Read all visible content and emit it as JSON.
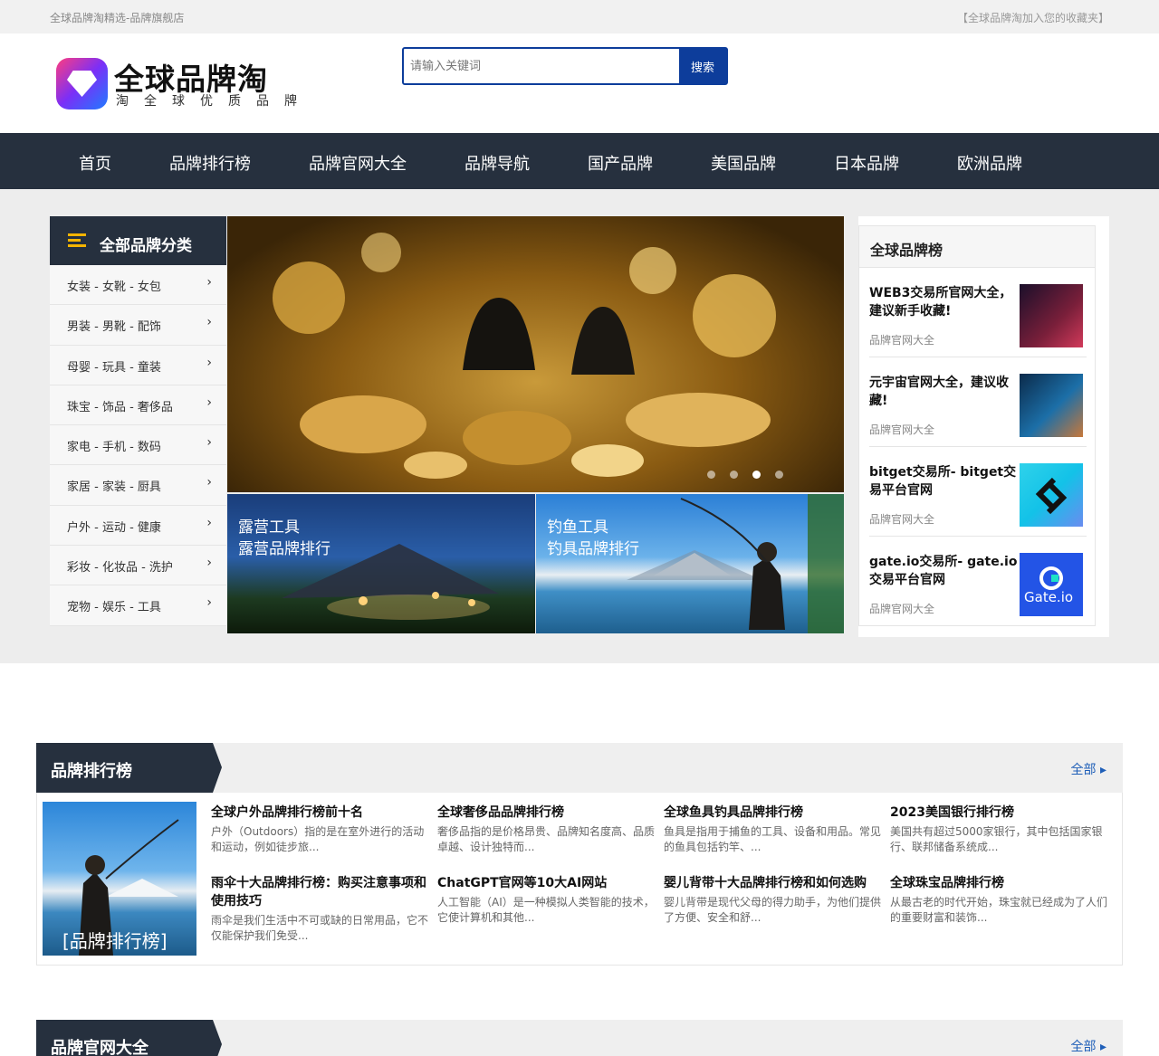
{
  "topbar": {
    "left_a": "全球品牌淘精选",
    "left_b": "-品牌旗舰店",
    "right": "【全球品牌淘加入您的收藏夹】"
  },
  "logo": {
    "name": "全球品牌淘",
    "slogan": "淘全球优质品牌"
  },
  "search": {
    "placeholder": "请输入关键词",
    "button": "搜索"
  },
  "nav": [
    "首页",
    "品牌排行榜",
    "品牌官网大全",
    "品牌导航",
    "国产品牌",
    "美国品牌",
    "日本品牌",
    "欧洲品牌"
  ],
  "categories": {
    "title": "全部品牌分类",
    "items": [
      "女装 - 女靴 - 女包",
      "男装 - 男靴 - 配饰",
      "母婴 - 玩具 - 童装",
      "珠宝 - 饰品 - 奢侈品",
      "家电 - 手机 - 数码",
      "家居 - 家装 - 厨具",
      "户外 - 运动 - 健康",
      "彩妆 - 化妆品 - 洗护",
      "宠物 - 娱乐 - 工具"
    ]
  },
  "hero": {
    "slide_count": 4,
    "active_slide": 3
  },
  "tiles": [
    {
      "line1": "露营工具",
      "line2": "露营品牌排行"
    },
    {
      "line1": "钓鱼工具",
      "line2": "钓具品牌排行"
    }
  ],
  "ranking": {
    "title": "全球品牌榜",
    "entries": [
      {
        "title": "WEB3交易所官网大全，建议新手收藏!",
        "category": "品牌官网大全",
        "image": "web3-image",
        "color": "#7a1f3a"
      },
      {
        "title": "元宇宙官网大全，建议收藏!",
        "category": "品牌官网大全",
        "image": "metaverse-image",
        "color": "#1c6fa8"
      },
      {
        "title": "bitget交易所- bitget交易平台官网",
        "category": "品牌官网大全",
        "image": "bitget-logo",
        "color": "#13c2e8"
      },
      {
        "title": "gate.io交易所- gate.io交易平台官网",
        "category": "品牌官网大全",
        "image": "gateio-logo",
        "color": "#2354e6",
        "logo_text": "Gate.io"
      }
    ]
  },
  "sections": [
    {
      "title": "品牌排行榜",
      "more": "全部",
      "feature_caption": "[品牌排行榜]",
      "articles": [
        {
          "title": "全球户外品牌排行榜前十名",
          "summary": "户外（Outdoors）指的是在室外进行的活动和运动，例如徒步旅..."
        },
        {
          "title": "全球奢侈品品牌排行榜",
          "summary": "奢侈品指的是价格昂贵、品牌知名度高、品质卓越、设计独特而..."
        },
        {
          "title": "全球鱼具钓具品牌排行榜",
          "summary": "鱼具是指用于捕鱼的工具、设备和用品。常见的鱼具包括钓竿、..."
        },
        {
          "title": "2023美国银行排行榜",
          "summary": "美国共有超过5000家银行，其中包括国家银行、联邦储备系统成..."
        },
        {
          "title": "雨伞十大品牌排行榜：购买注意事项和使用技巧",
          "summary": "雨伞是我们生活中不可或缺的日常用品，它不仅能保护我们免受..."
        },
        {
          "title": "ChatGPT官网等10大AI网站",
          "summary": "人工智能（AI）是一种模拟人类智能的技术，它使计算机和其他..."
        },
        {
          "title": "婴儿背带十大品牌排行榜和如何选购",
          "summary": "婴儿背带是现代父母的得力助手，为他们提供了方便、安全和舒..."
        },
        {
          "title": "全球珠宝品牌排行榜",
          "summary": "从最古老的时代开始，珠宝就已经成为了人们的重要财富和装饰..."
        }
      ]
    },
    {
      "title": "品牌官网大全",
      "more": "全部"
    }
  ],
  "colors": {
    "nav_bg": "#26303e",
    "accent_blue": "#0d3d9b",
    "link_blue": "#1f5fb8",
    "icon_yellow": "#f5b400"
  }
}
